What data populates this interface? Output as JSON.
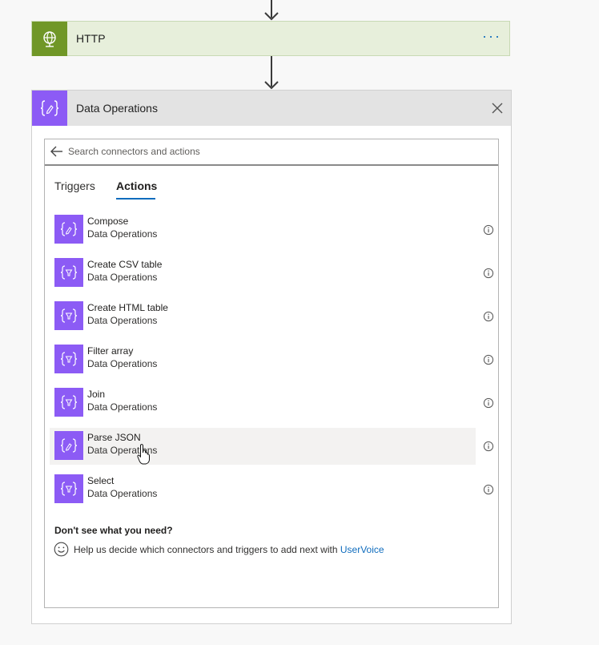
{
  "http_card": {
    "title": "HTTP",
    "icon": "globe-icon",
    "more_label": "···",
    "accent": "#709727"
  },
  "dataops_card": {
    "title": "Data Operations",
    "icon": "curly-braces-icon",
    "accent": "#8c5bf5"
  },
  "search": {
    "placeholder": "Search connectors and actions",
    "value": ""
  },
  "tabs": [
    {
      "label": "Triggers",
      "selected": false
    },
    {
      "label": "Actions",
      "selected": true
    }
  ],
  "actions": [
    {
      "name": "Compose",
      "connector": "Data Operations",
      "icon": "pencil-icon"
    },
    {
      "name": "Create CSV table",
      "connector": "Data Operations",
      "icon": "filter-icon"
    },
    {
      "name": "Create HTML table",
      "connector": "Data Operations",
      "icon": "filter-icon"
    },
    {
      "name": "Filter array",
      "connector": "Data Operations",
      "icon": "filter-icon"
    },
    {
      "name": "Join",
      "connector": "Data Operations",
      "icon": "filter-icon"
    },
    {
      "name": "Parse JSON",
      "connector": "Data Operations",
      "icon": "pencil-icon",
      "hovered": true
    },
    {
      "name": "Select",
      "connector": "Data Operations",
      "icon": "filter-icon"
    }
  ],
  "help": {
    "title": "Don't see what you need?",
    "text": "Help us decide which connectors and triggers to add next with",
    "link": "UserVoice"
  },
  "colors": {
    "link": "#0f6cbd",
    "hover_row": "#f3f2f1"
  }
}
